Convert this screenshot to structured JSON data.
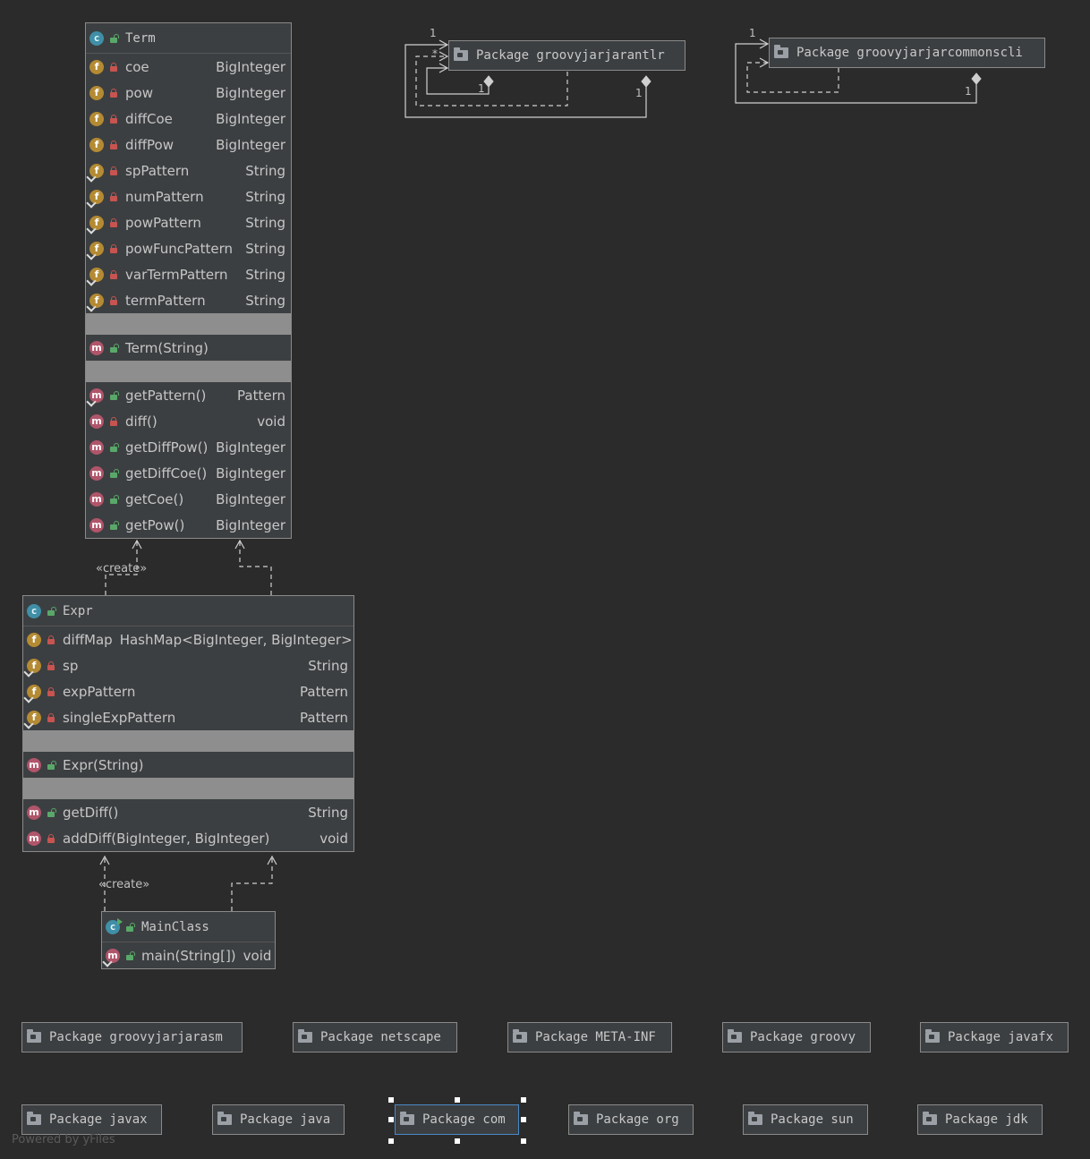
{
  "classes": {
    "term": {
      "name": "Term",
      "fields": [
        {
          "name": "coe",
          "type": "BigInteger"
        },
        {
          "name": "pow",
          "type": "BigInteger"
        },
        {
          "name": "diffCoe",
          "type": "BigInteger"
        },
        {
          "name": "diffPow",
          "type": "BigInteger"
        },
        {
          "name": "spPattern",
          "type": "String"
        },
        {
          "name": "numPattern",
          "type": "String"
        },
        {
          "name": "powPattern",
          "type": "String"
        },
        {
          "name": "powFuncPattern",
          "type": "String"
        },
        {
          "name": "varTermPattern",
          "type": "String"
        },
        {
          "name": "termPattern",
          "type": "String"
        }
      ],
      "constructors": [
        {
          "name": "Term(String)"
        }
      ],
      "methods": [
        {
          "name": "getPattern()",
          "type": "Pattern"
        },
        {
          "name": "diff()",
          "type": "void"
        },
        {
          "name": "getDiffPow()",
          "type": "BigInteger"
        },
        {
          "name": "getDiffCoe()",
          "type": "BigInteger"
        },
        {
          "name": "getCoe()",
          "type": "BigInteger"
        },
        {
          "name": "getPow()",
          "type": "BigInteger"
        }
      ]
    },
    "expr": {
      "name": "Expr",
      "fields": [
        {
          "name": "diffMap",
          "type": "HashMap<BigInteger, BigInteger>"
        },
        {
          "name": "sp",
          "type": "String"
        },
        {
          "name": "expPattern",
          "type": "Pattern"
        },
        {
          "name": "singleExpPattern",
          "type": "Pattern"
        }
      ],
      "constructors": [
        {
          "name": "Expr(String)"
        }
      ],
      "methods": [
        {
          "name": "getDiff()",
          "type": "String"
        },
        {
          "name": "addDiff(BigInteger, BigInteger)",
          "type": "void"
        }
      ]
    },
    "mainclass": {
      "name": "MainClass",
      "methods": [
        {
          "name": "main(String[])",
          "type": "void"
        }
      ]
    }
  },
  "icons": {
    "class": "class-icon",
    "field": "field-icon",
    "method": "method-icon",
    "private": "lock-icon",
    "public": "unlock-icon",
    "package": "folder-icon"
  },
  "labels": {
    "create_term": "«create»",
    "create_expr": "«create»",
    "mult_one": "1",
    "mult_many": "*"
  },
  "packages": {
    "antlr": "Package groovyjarjarantlr",
    "commonscli": "Package groovyjarjarcommonscli",
    "asm": "Package groovyjarjarasm",
    "netscape": "Package netscape",
    "metainf": "Package META-INF",
    "groovy": "Package groovy",
    "javafx": "Package javafx",
    "javax": "Package javax",
    "java": "Package java",
    "com": "Package com",
    "org": "Package org",
    "sun": "Package sun",
    "jdk": "Package jdk"
  },
  "footer": "Powered by yFiles",
  "colors": {
    "background": "#2b2b2b",
    "node": "#3c3f41",
    "separator": "#8e8e8e",
    "selection": "#4a88c7"
  }
}
